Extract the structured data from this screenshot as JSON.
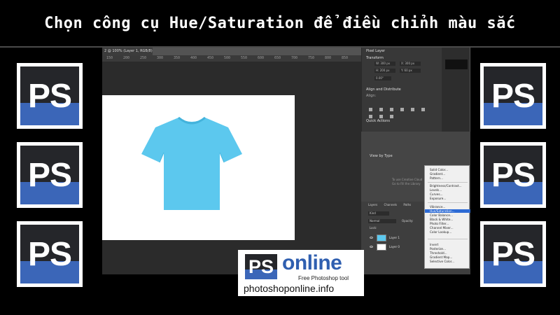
{
  "header": {
    "title": "Chọn công cụ Hue/Saturation để điều chỉnh màu sắc"
  },
  "logos": {
    "ps_text": "PS"
  },
  "photoshop": {
    "doc_tab": "2 @ 100% (Layer 1, RGB/8)",
    "ruler_ticks": [
      "150",
      "200",
      "250",
      "300",
      "350",
      "400",
      "450",
      "500",
      "550",
      "600",
      "650",
      "700",
      "750",
      "800",
      "850",
      "900"
    ],
    "properties": {
      "header": "Pixel Layer",
      "transform_label": "Transform",
      "w": "W: 300 px",
      "h": "H: 200 px",
      "x": "X: 300 px",
      "y": "Y: 60 px",
      "angle": "0.00°",
      "align_label": "Align and Distribute",
      "align_sub": "Align:",
      "quick_actions": "Quick Actions"
    },
    "mid_panel": {
      "view_by": "View by Type",
      "cc_line1": "To use Creative Cloud",
      "cc_line2": "Go to Fill the Library"
    },
    "layers": {
      "tabs": [
        "Layers",
        "Channels",
        "Paths"
      ],
      "kind": "Kind",
      "blend": "Normal",
      "opacity": "Opacity:",
      "lock": "Lock:",
      "layer1": "Layer 1",
      "layer0": "Layer 0"
    },
    "adjust_menu": {
      "items": [
        "Solid Color...",
        "Gradient...",
        "Pattern...",
        "Brightness/Contrast...",
        "Levels...",
        "Curves...",
        "Exposure...",
        "Vibrance...",
        "Hue/Saturation...",
        "Color Balance...",
        "Black & White...",
        "Photo Filter...",
        "Channel Mixer...",
        "Color Lookup...",
        "Invert",
        "Posterize...",
        "Threshold...",
        "Gradient Map...",
        "Selective Color..."
      ],
      "highlighted": "Hue/Saturation..."
    }
  },
  "brand": {
    "ps": "PS",
    "wordmark": "online",
    "tagline": "Free Photoshop tool",
    "url": "photoshoponline.info"
  },
  "colors": {
    "background": "#000000",
    "ps_blue": "#3b66b8",
    "ps_dark": "#25262a",
    "tshirt": "#5cc8ee",
    "menu_highlight": "#2d6bd5"
  }
}
